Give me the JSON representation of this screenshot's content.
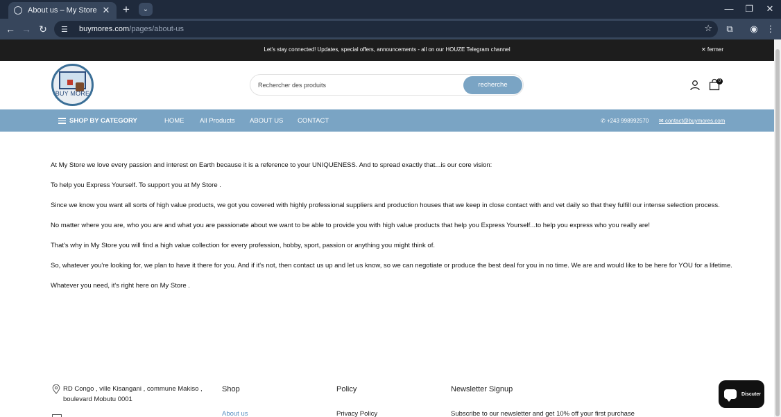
{
  "browser": {
    "tab_title": "About us – My Store",
    "new_tab": "+",
    "url_host": "buymores.com",
    "url_path": "/pages/about-us"
  },
  "announcement": {
    "text": "Let's stay connected! Updates, special offers, announcements - all on our HOUZE Telegram channel",
    "close_label": "fermer"
  },
  "header": {
    "logo_text": "BUY MORE",
    "search_placeholder": "Rechercher des produits",
    "search_button": "recherche",
    "cart_count": "0"
  },
  "nav": {
    "category": "SHOP BY CATEGORY",
    "links": [
      "HOME",
      "All Products",
      "ABOUT US",
      "CONTACT"
    ],
    "phone": "+243 998992570",
    "email": "contact@buymores.com"
  },
  "content": {
    "paragraphs": [
      "At My Store  we love every passion and interest on Earth because it is a reference to your UNIQUENESS. And to spread exactly that...is our core vision:",
      "To help you Express Yourself. To support you at My Store .",
      "Since we know you want all sorts of high value products, we got you covered with highly professional suppliers and production houses that we keep in close contact with and vet daily so that they fulfill our intense selection process.",
      "No matter where you are, who you are and what you are passionate about we want to be able to provide you with high value products that help you Express Yourself...to help you express who you really are!",
      "That's why in My Store  you will find a high value collection for every profession, hobby, sport, passion or anything you might think of.",
      "So, whatever you're looking for, we plan to have it there for you. And if it's not, then contact us up and let us know, so we can negotiate or produce the best deal for you in no time. We are and would like to be here for YOU for a lifetime.",
      "Whatever you need, it's right here on My Store ."
    ]
  },
  "footer": {
    "address_line1": "RD Congo , ville Kisangani , commune Makiso ,",
    "address_line2": "boulevard Mobutu 0001",
    "col_shop": "Shop",
    "col_policy": "Policy",
    "col_newsletter": "Newsletter Signup",
    "link_about": "About us",
    "link_privacy": "Privacy Policy",
    "newsletter_text": "Subscribe to our newsletter and get 10% off your first purchase"
  },
  "chat": {
    "label": "Discuter"
  },
  "colors": {
    "brand": "#7aa4c4",
    "announce_bg": "#1d1d1d",
    "link": "#5a8fc0"
  }
}
